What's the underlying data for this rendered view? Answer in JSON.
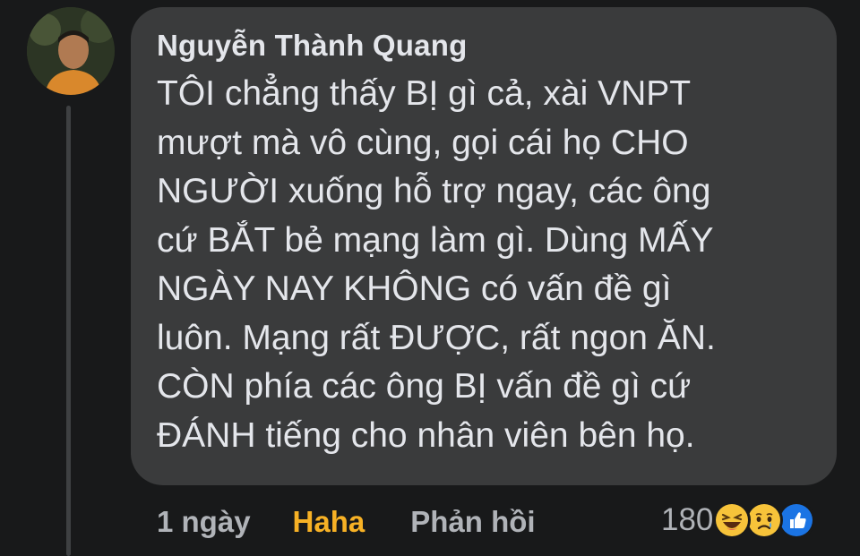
{
  "comment": {
    "author": "Nguyễn Thành Quang",
    "text": "TÔI chẳng thấy BỊ gì cả, xài VNPT\nmượt mà vô cùng, gọi cái họ CHO\nNGƯỜI xuống hỗ trợ ngay, các ông\ncứ BẮT bẻ mạng làm gì. Dùng MẤY\nNGÀY NAY KHÔNG có vấn đề gì\nluôn. Mạng rất ĐƯỢC, rất ngon ĂN.\nCÒN phía các ông BỊ vấn đề gì cứ\nĐÁNH tiếng cho nhân viên bên họ."
  },
  "footer": {
    "time": "1 ngày",
    "reaction_label": "Haha",
    "reply_label": "Phản hồi"
  },
  "reactions": {
    "count": "180",
    "icons": [
      "haha-icon",
      "sad-icon",
      "like-icon"
    ]
  },
  "colors": {
    "background": "#18191a",
    "bubble": "#3a3b3c",
    "text": "#e4e6eb",
    "secondary": "#b0b3b8",
    "haha_accent": "#f7b125",
    "like_blue": "#1b74e4"
  }
}
